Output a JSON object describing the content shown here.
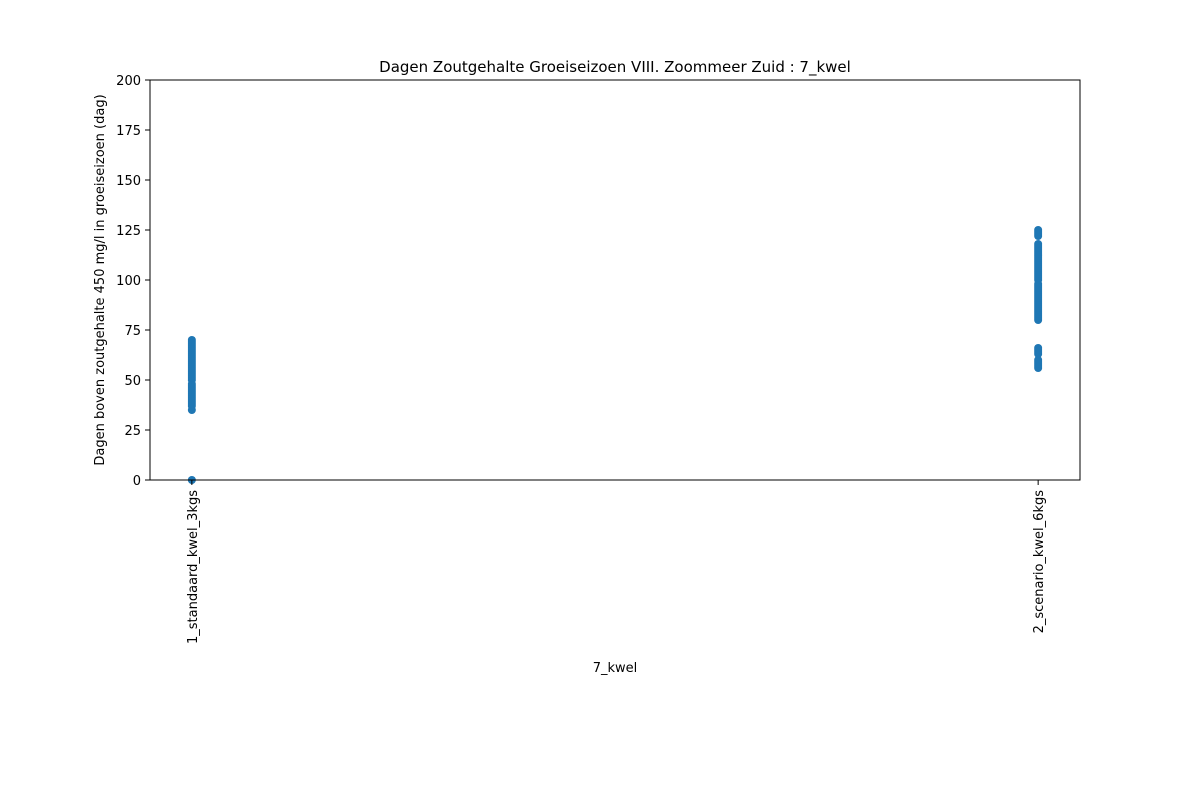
{
  "chart_data": {
    "type": "scatter",
    "title": "Dagen Zoutgehalte Groeiseizoen VIII. Zoommeer Zuid : 7_kwel",
    "xlabel": "7_kwel",
    "ylabel": "Dagen boven zoutgehalte 450 mg/l in groeiseizoen (dag)",
    "ylim": [
      0,
      200
    ],
    "yticks": [
      0,
      25,
      50,
      75,
      100,
      125,
      150,
      175,
      200
    ],
    "grid": false,
    "point_color": "#1f77b4",
    "categories": [
      "1_standaard_kwel_3kgs",
      "2_scenario_kwel_6kgs"
    ],
    "series": [
      {
        "category": "1_standaard_kwel_3kgs",
        "values": [
          0,
          35,
          37,
          38,
          39,
          40,
          41,
          42,
          43,
          44,
          45,
          46,
          47,
          48,
          50,
          51,
          52,
          53,
          54,
          55,
          56,
          57,
          58,
          59,
          60,
          61,
          62,
          63,
          64,
          65,
          66,
          67,
          68,
          69,
          70
        ]
      },
      {
        "category": "2_scenario_kwel_6kgs",
        "values": [
          56,
          57,
          58,
          59,
          60,
          63,
          64,
          65,
          66,
          80,
          81,
          82,
          83,
          84,
          85,
          86,
          87,
          88,
          89,
          90,
          91,
          92,
          93,
          94,
          95,
          96,
          97,
          98,
          100,
          101,
          102,
          103,
          104,
          105,
          106,
          107,
          108,
          109,
          110,
          111,
          112,
          113,
          114,
          115,
          116,
          117,
          118,
          122,
          123,
          124,
          125
        ]
      }
    ]
  }
}
